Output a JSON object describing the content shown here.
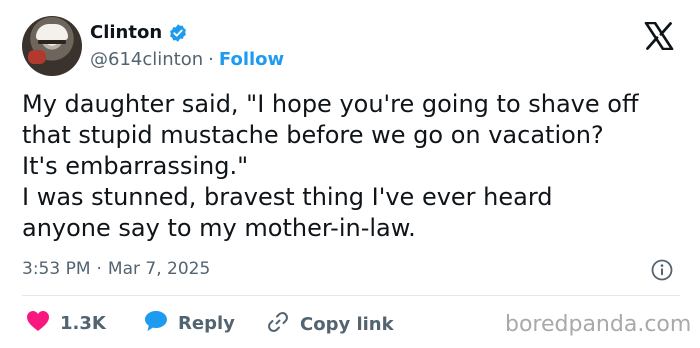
{
  "author": {
    "name": "Clinton",
    "handle": "@614clinton",
    "separator": "·",
    "follow_label": "Follow",
    "verified": true,
    "avatar_icon": "avatar"
  },
  "platform_icon": "x-logo-icon",
  "tweet": {
    "text": "My daughter said, \"I hope you're going to shave off\nthat stupid mustache before we go on vacation?\nIt's embarrassing.\"\nI was stunned, bravest thing I've ever heard\nanyone say to my mother-in-law.",
    "time": "3:53 PM",
    "meta_separator": "·",
    "date": "Mar 7, 2025"
  },
  "actions": {
    "likes": "1.3K",
    "reply_label": "Reply",
    "copy_label": "Copy link"
  },
  "watermark": "boredpanda.com",
  "colors": {
    "text": "#0f1419",
    "secondary": "#536471",
    "accent": "#1d9bf0",
    "like": "#f91880"
  }
}
